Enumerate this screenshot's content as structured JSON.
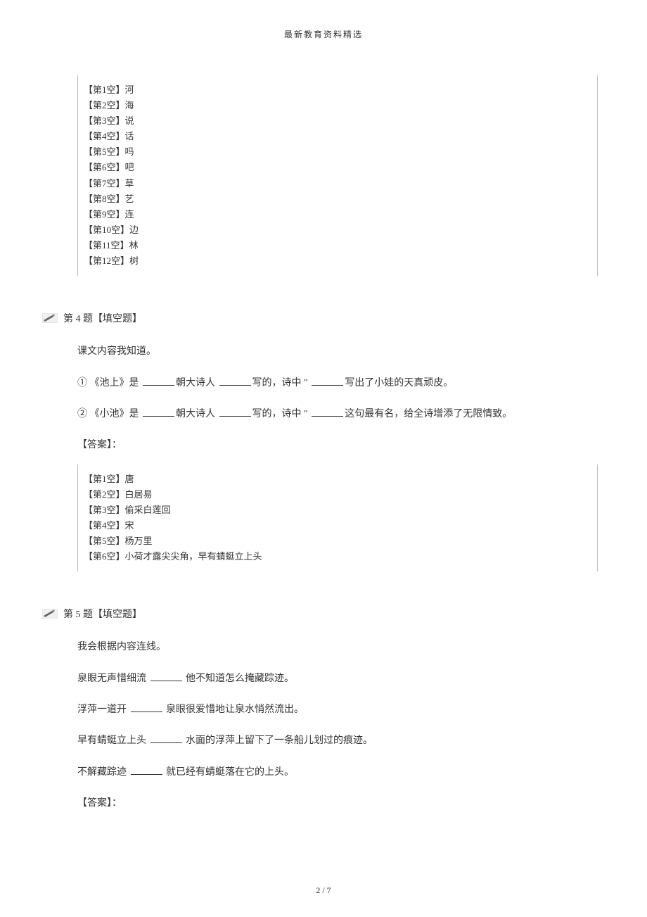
{
  "header": "最新教育资料精选",
  "footer": "2 / 7",
  "block1": {
    "lines": [
      "【第1空】河",
      "【第2空】海",
      "【第3空】说",
      "【第4空】话",
      "【第5空】吗",
      "【第6空】吧",
      "【第7空】草",
      "【第8空】艺",
      "【第9空】连",
      "【第10空】边",
      "【第11空】林",
      "【第12空】树"
    ]
  },
  "q4": {
    "title": "第 4 题【填空题】",
    "intro": "课文内容我知道。",
    "line1_a": "① 《池上》是 ",
    "line1_b": "朝大诗人 ",
    "line1_c": "写的，诗中 \" ",
    "line1_d": "写出了小娃的天真顽皮。",
    "line2_a": "② 《小池》是 ",
    "line2_b": "朝大诗人 ",
    "line2_c": "写的，诗中 \" ",
    "line2_d": "这句最有名，给全诗增添了无限情致。",
    "answer_label": "【答案】：",
    "answers": [
      "【第1空】唐",
      "【第2空】白居易",
      "【第3空】偷采白莲回",
      "【第4空】宋",
      "【第5空】杨万里",
      "【第6空】小荷才露尖尖角，早有蜻蜓立上头"
    ]
  },
  "q5": {
    "title": "第 5 题【填空题】",
    "intro": "我会根据内容连线。",
    "line1_a": "泉眼无声惜细流 ",
    "line1_b": " 他不知道怎么掩藏踪迹。",
    "line2_a": "浮萍一道开 ",
    "line2_b": " 泉眼很爱惜地让泉水悄然流出。",
    "line3_a": "早有蜻蜓立上头 ",
    "line3_b": " 水面的浮萍上留下了一条船儿划过的痕迹。",
    "line4_a": "不解藏踪迹 ",
    "line4_b": " 就已经有蜻蜓落在它的上头。",
    "answer_label": "【答案】："
  }
}
